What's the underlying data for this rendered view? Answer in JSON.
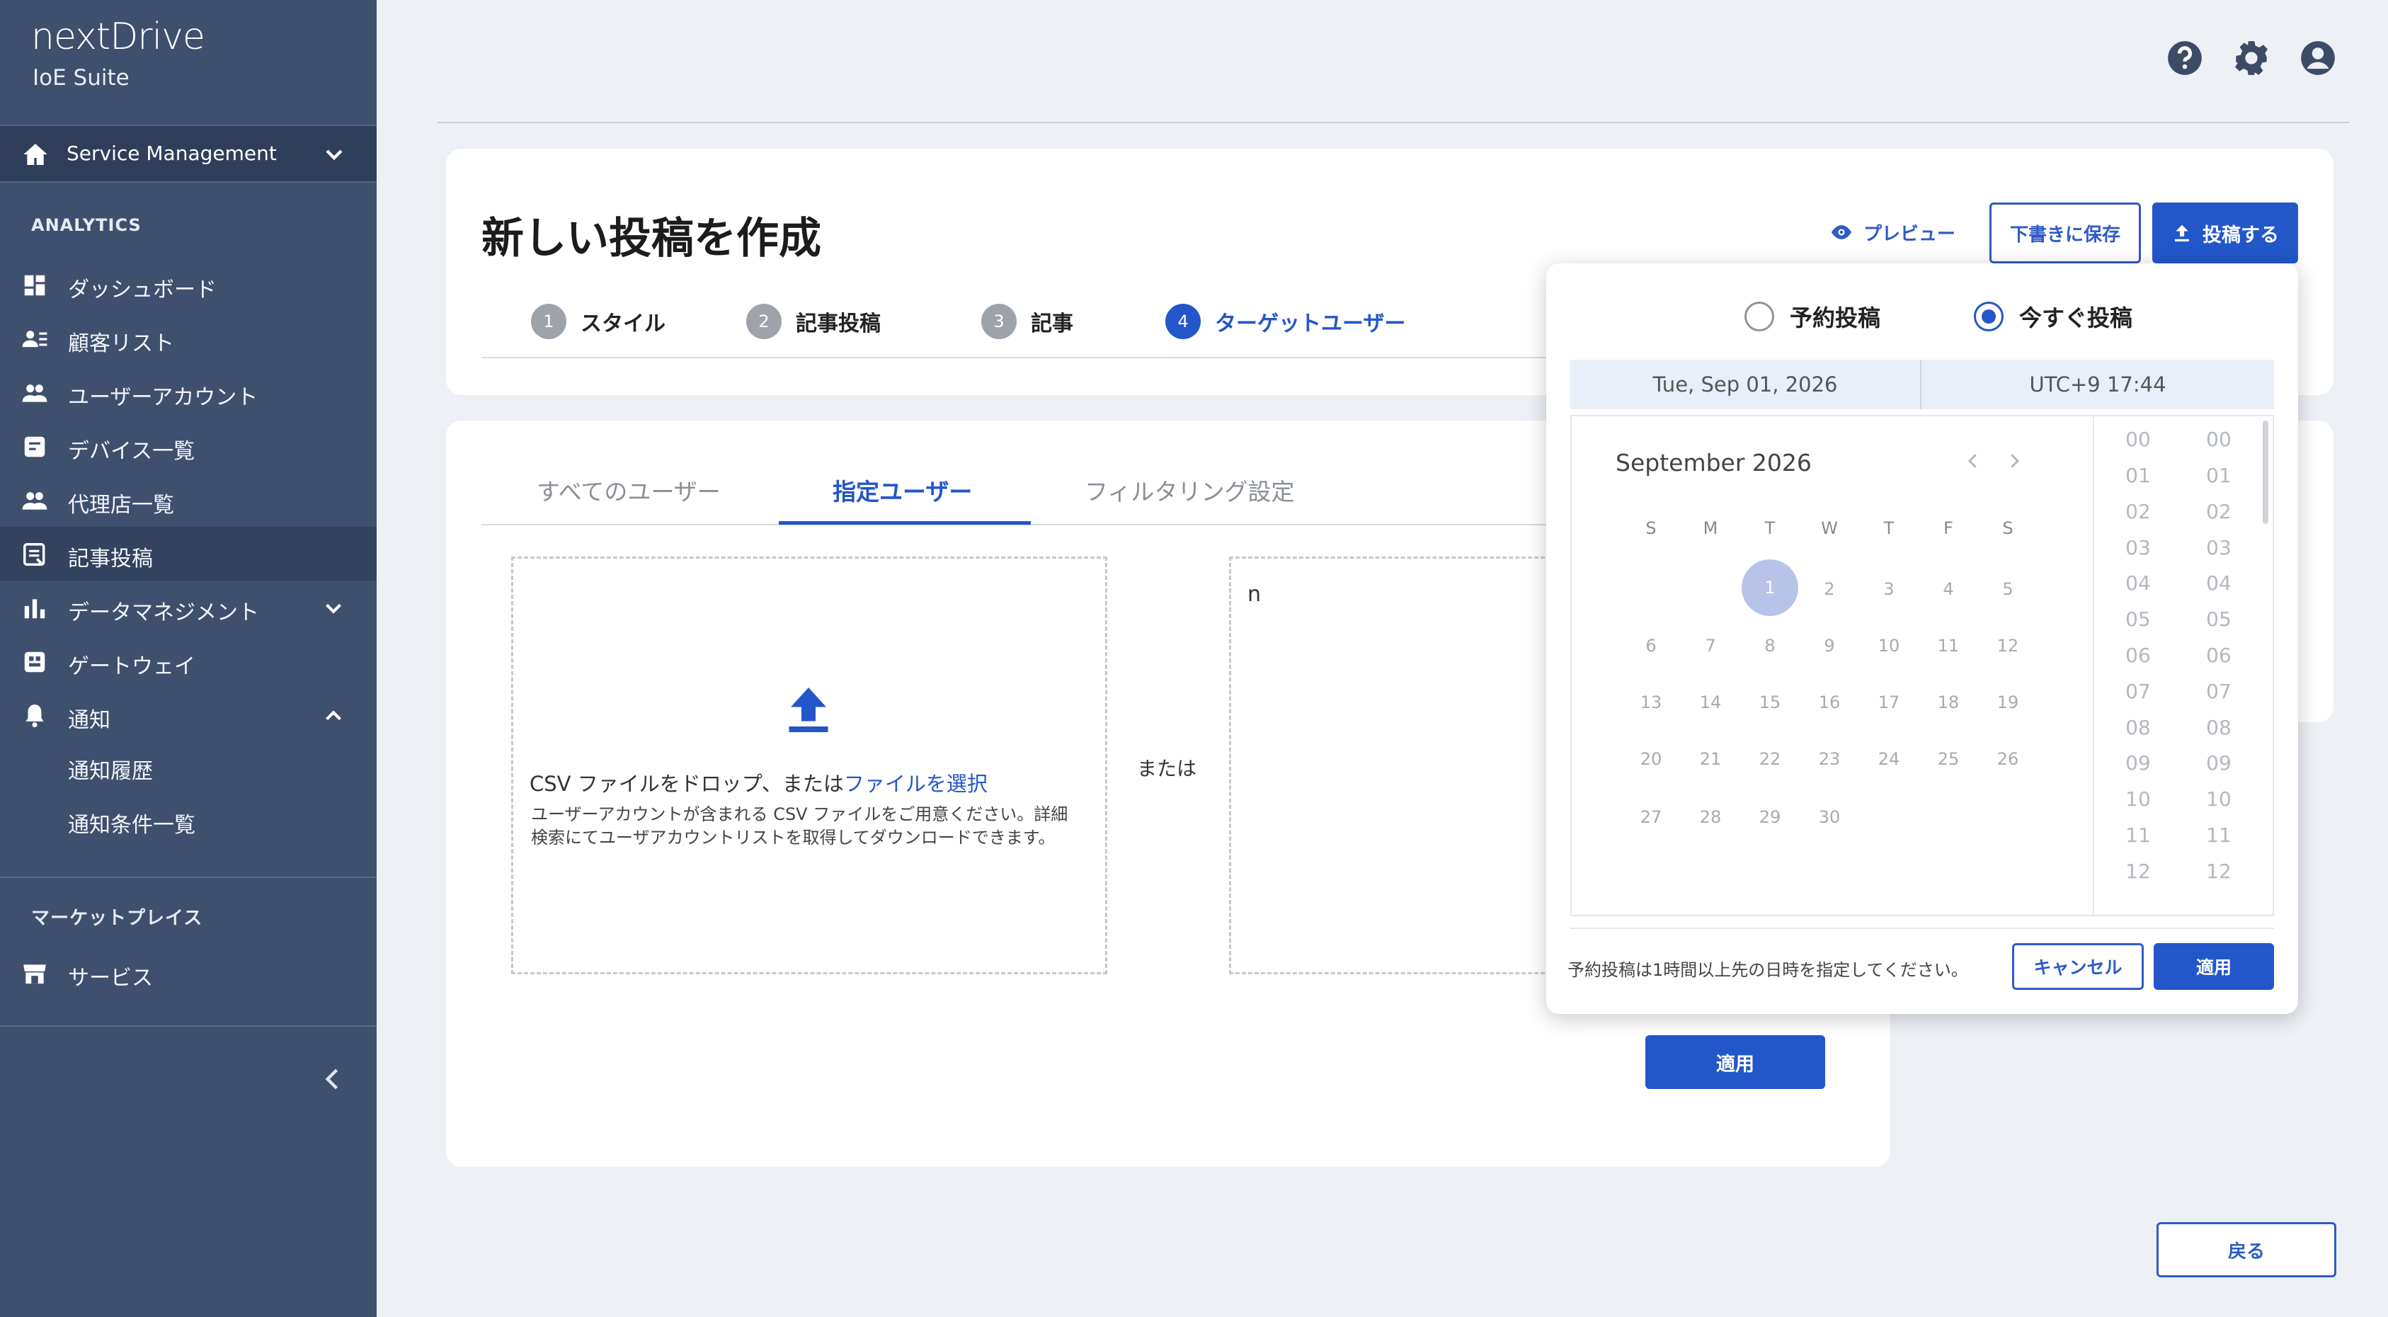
{
  "brand": {
    "logo": "nextDrive",
    "suite": "IoE Suite"
  },
  "sidebar": {
    "service": "Service Management",
    "analytics_header": "ANALYTICS",
    "items": [
      {
        "label": "ダッシュボード"
      },
      {
        "label": "顧客リスト"
      },
      {
        "label": "ユーザーアカウント"
      },
      {
        "label": "デバイス一覧"
      },
      {
        "label": "代理店一覧"
      },
      {
        "label": "記事投稿"
      },
      {
        "label": "データマネジメント"
      },
      {
        "label": "ゲートウェイ"
      },
      {
        "label": "通知"
      }
    ],
    "notify_sub": [
      {
        "label": "通知履歴"
      },
      {
        "label": "通知条件一覧"
      }
    ],
    "market_header": "マーケットプレイス",
    "market_items": [
      {
        "label": "サービス"
      }
    ]
  },
  "page": {
    "title": "新しい投稿を作成",
    "preview": "プレビュー",
    "save_draft": "下書きに保存",
    "post": "投稿する",
    "steps": [
      {
        "num": "1",
        "label": "スタイル"
      },
      {
        "num": "2",
        "label": "記事投稿"
      },
      {
        "num": "3",
        "label": "記事"
      },
      {
        "num": "4",
        "label": "ターゲットユーザー"
      }
    ],
    "tabs": [
      {
        "label": "すべてのユーザー"
      },
      {
        "label": "指定ユーザー"
      },
      {
        "label": "フィルタリング設定"
      }
    ],
    "dropzone": {
      "main": "CSV ファイルをドロップ、または",
      "link": "ファイルを選択",
      "desc": "ユーザーアカウントが含まれる CSV ファイルをご用意ください。詳細検索にてユーザアカウントリストを取得してダウンロードできます。"
    },
    "or": "または",
    "textarea_value": "n",
    "apply": "適用",
    "back": "戻る"
  },
  "popover": {
    "radio_scheduled": "予約投稿",
    "radio_now": "今すぐ投稿",
    "date": "Tue, Sep 01, 2026",
    "time": "UTC+9 17:44",
    "month": "September 2026",
    "weekdays": [
      "S",
      "M",
      "T",
      "W",
      "T",
      "F",
      "S"
    ],
    "days": [
      "1",
      "2",
      "3",
      "4",
      "5",
      "6",
      "7",
      "8",
      "9",
      "10",
      "11",
      "12",
      "13",
      "14",
      "15",
      "16",
      "17",
      "18",
      "19",
      "20",
      "21",
      "22",
      "23",
      "24",
      "25",
      "26",
      "27",
      "28",
      "29",
      "30"
    ],
    "selected_day": "1",
    "hours": [
      "00",
      "01",
      "02",
      "03",
      "04",
      "05",
      "06",
      "07",
      "08",
      "09",
      "10",
      "11",
      "12"
    ],
    "minutes": [
      "00",
      "01",
      "02",
      "03",
      "04",
      "05",
      "06",
      "07",
      "08",
      "09",
      "10",
      "11",
      "12"
    ],
    "note": "予約投稿は1時間以上先の日時を指定してください。",
    "cancel": "キャンセル",
    "apply": "適用"
  },
  "colors": {
    "sidebar": "#3f4f6e",
    "accent": "#2356c9",
    "background": "#edf0f5"
  }
}
